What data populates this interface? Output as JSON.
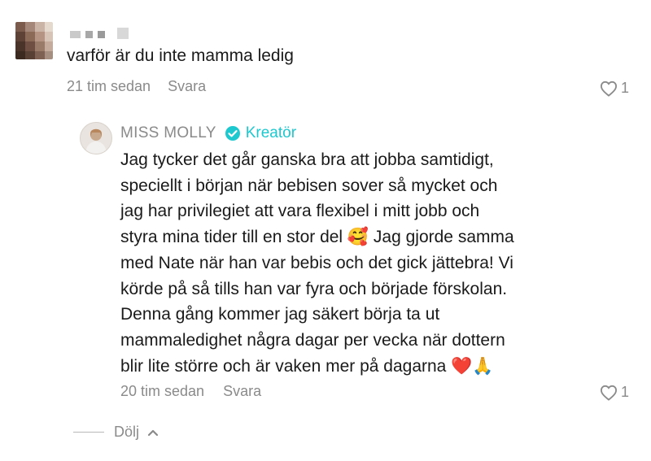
{
  "comment": {
    "username": "",
    "text": "varför är du inte mamma ledig",
    "time": "21 tim sedan",
    "reply_label": "Svara",
    "likes": "1"
  },
  "reply": {
    "author": "MISS MOLLY",
    "badge": "Kreatör",
    "text_lines": [
      "Jag tycker det går ganska bra att jobba samtidigt,",
      "speciellt i början när bebisen sover så mycket och",
      "jag har privilegiet att vara flexibel i mitt jobb och",
      "styra mina tider till en stor del 🥰 Jag gjorde samma",
      "med Nate när han var bebis och det gick jättebra! Vi",
      "körde på så tills han var fyra och började förskolan.",
      "Denna gång kommer jag säkert börja ta ut",
      "mammaledighet några dagar per vecka när dottern",
      "blir lite större och är vaken mer på dagarna ❤️🙏"
    ],
    "time": "20 tim sedan",
    "reply_label": "Svara",
    "likes": "1"
  },
  "hide_label": "Dölj",
  "colors": {
    "text": "#1a1a1a",
    "muted": "#8a8a8a",
    "accent": "#1ec8cf"
  }
}
